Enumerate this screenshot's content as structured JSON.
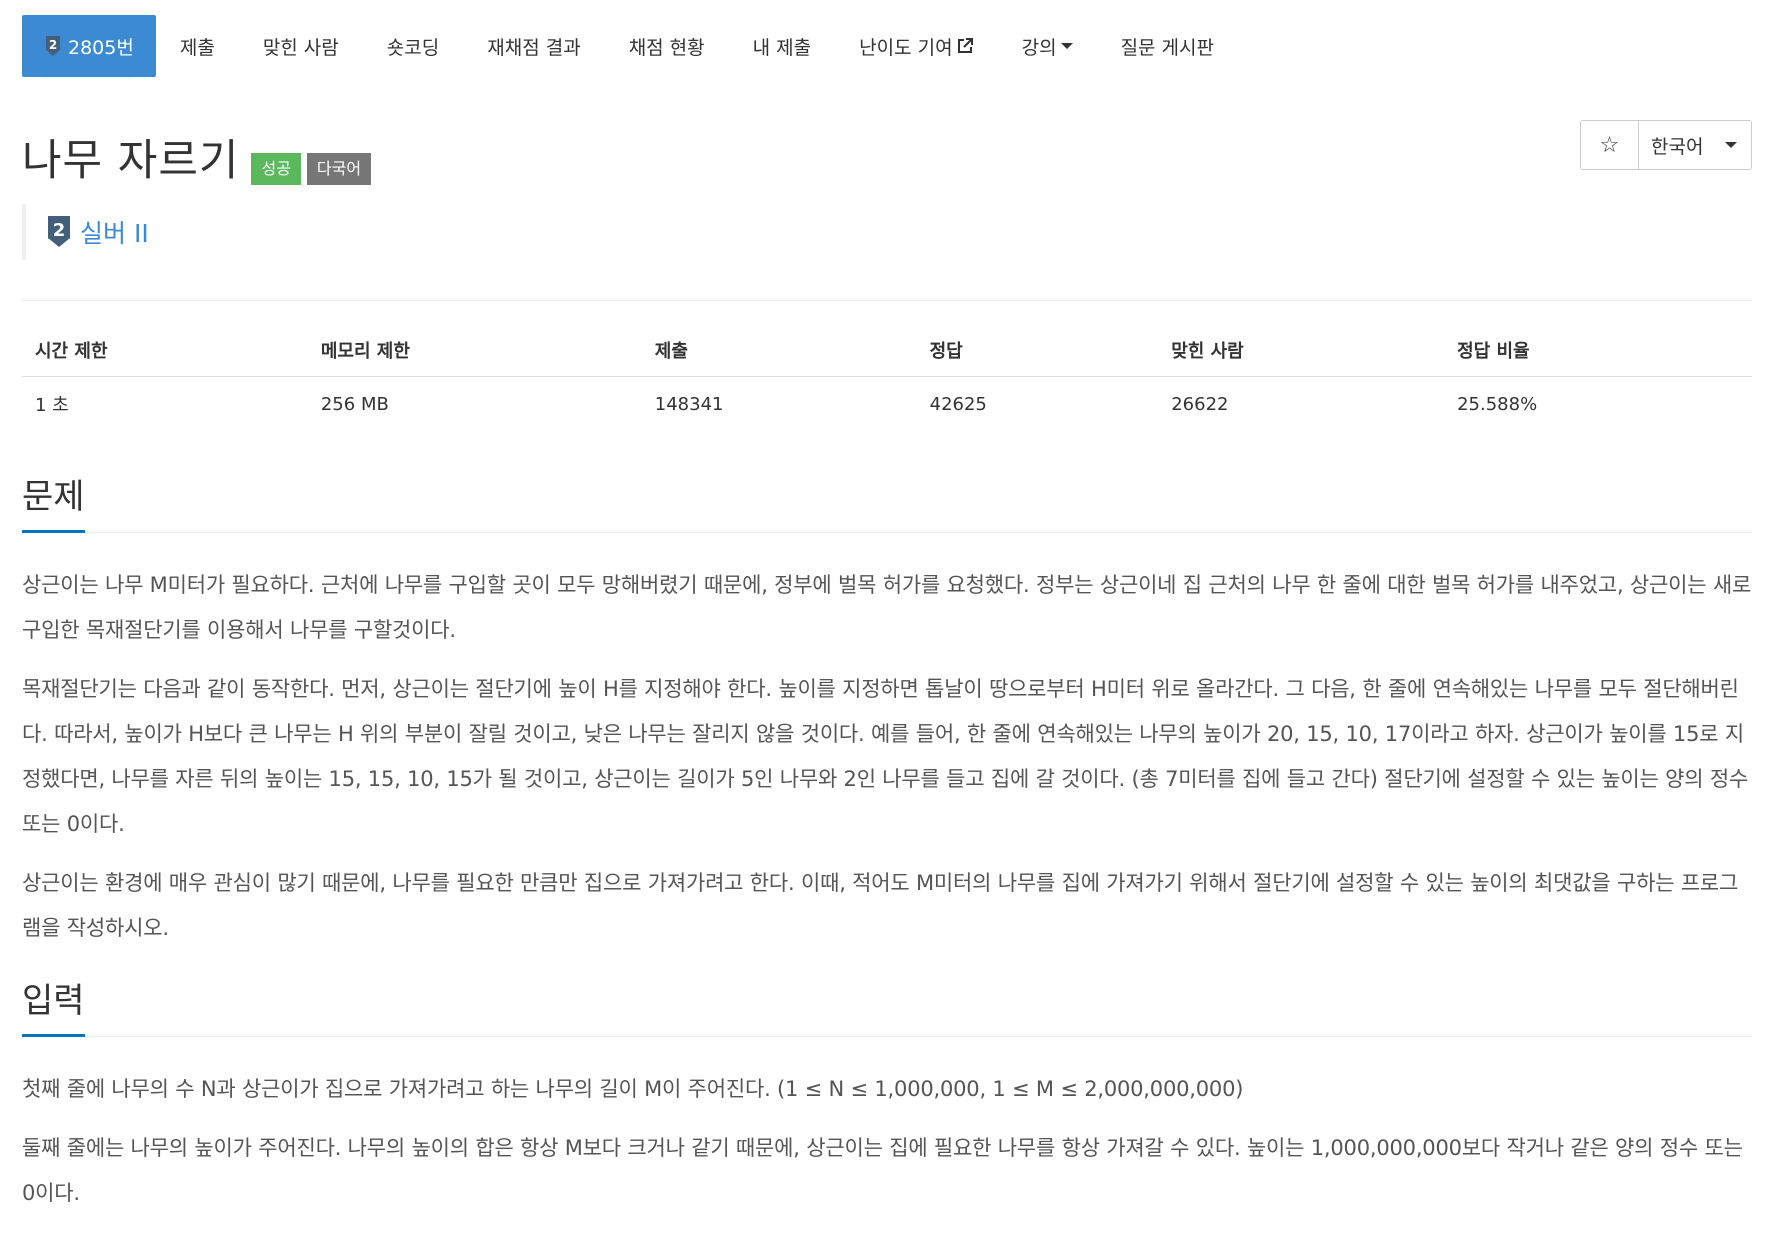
{
  "nav": {
    "items": [
      {
        "label": "2805번",
        "active": true,
        "tier": "2"
      },
      {
        "label": "제출"
      },
      {
        "label": "맞힌 사람"
      },
      {
        "label": "숏코딩"
      },
      {
        "label": "재채점 결과"
      },
      {
        "label": "채점 현황"
      },
      {
        "label": "내 제출"
      },
      {
        "label": "난이도 기여"
      },
      {
        "label": "강의"
      },
      {
        "label": "질문 게시판"
      }
    ]
  },
  "problem": {
    "title": "나무 자르기",
    "label_success": "성공",
    "label_multi": "다국어",
    "tier_number": "2",
    "tier_text": "실버 II",
    "language": "한국어",
    "star": "☆"
  },
  "info_table": {
    "headers": [
      "시간 제한",
      "메모리 제한",
      "제출",
      "정답",
      "맞힌 사람",
      "정답 비율"
    ],
    "values": [
      "1 초",
      "256 MB",
      "148341",
      "42625",
      "26622",
      "25.588%"
    ]
  },
  "sections": {
    "problem_title": "문제",
    "problem_paras": [
      "상근이는 나무 M미터가 필요하다. 근처에 나무를 구입할 곳이 모두 망해버렸기 때문에, 정부에 벌목 허가를 요청했다. 정부는 상근이네 집 근처의 나무 한 줄에 대한 벌목 허가를 내주었고, 상근이는 새로 구입한 목재절단기를 이용해서 나무를 구할것이다.",
      "목재절단기는 다음과 같이 동작한다. 먼저, 상근이는 절단기에 높이 H를 지정해야 한다. 높이를 지정하면 톱날이 땅으로부터 H미터 위로 올라간다. 그 다음, 한 줄에 연속해있는 나무를 모두 절단해버린다. 따라서, 높이가 H보다 큰 나무는 H 위의 부분이 잘릴 것이고, 낮은 나무는 잘리지 않을 것이다. 예를 들어, 한 줄에 연속해있는 나무의 높이가 20, 15, 10, 17이라고 하자. 상근이가 높이를 15로 지정했다면, 나무를 자른 뒤의 높이는 15, 15, 10, 15가 될 것이고, 상근이는 길이가 5인 나무와 2인 나무를 들고 집에 갈 것이다. (총 7미터를 집에 들고 간다) 절단기에 설정할 수 있는 높이는 양의 정수 또는 0이다.",
      "상근이는 환경에 매우 관심이 많기 때문에, 나무를 필요한 만큼만 집으로 가져가려고 한다. 이때, 적어도 M미터의 나무를 집에 가져가기 위해서 절단기에 설정할 수 있는 높이의 최댓값을 구하는 프로그램을 작성하시오."
    ],
    "input_title": "입력",
    "input_paras": [
      "첫째 줄에 나무의 수 N과 상근이가 집으로 가져가려고 하는 나무의 길이 M이 주어진다. (1 ≤ N ≤ 1,000,000, 1 ≤ M ≤ 2,000,000,000)",
      "둘째 줄에는 나무의 높이가 주어진다. 나무의 높이의 합은 항상 M보다 크거나 같기 때문에, 상근이는 집에 필요한 나무를 항상 가져갈 수 있다. 높이는 1,000,000,000보다 작거나 같은 양의 정수 또는 0이다."
    ]
  },
  "colors": {
    "nav_active": "#3c8ad1",
    "label_success": "#5cb85c",
    "label_multi": "#777777",
    "tier_silver": "#435f7a",
    "section_underline": "#0076c0"
  }
}
